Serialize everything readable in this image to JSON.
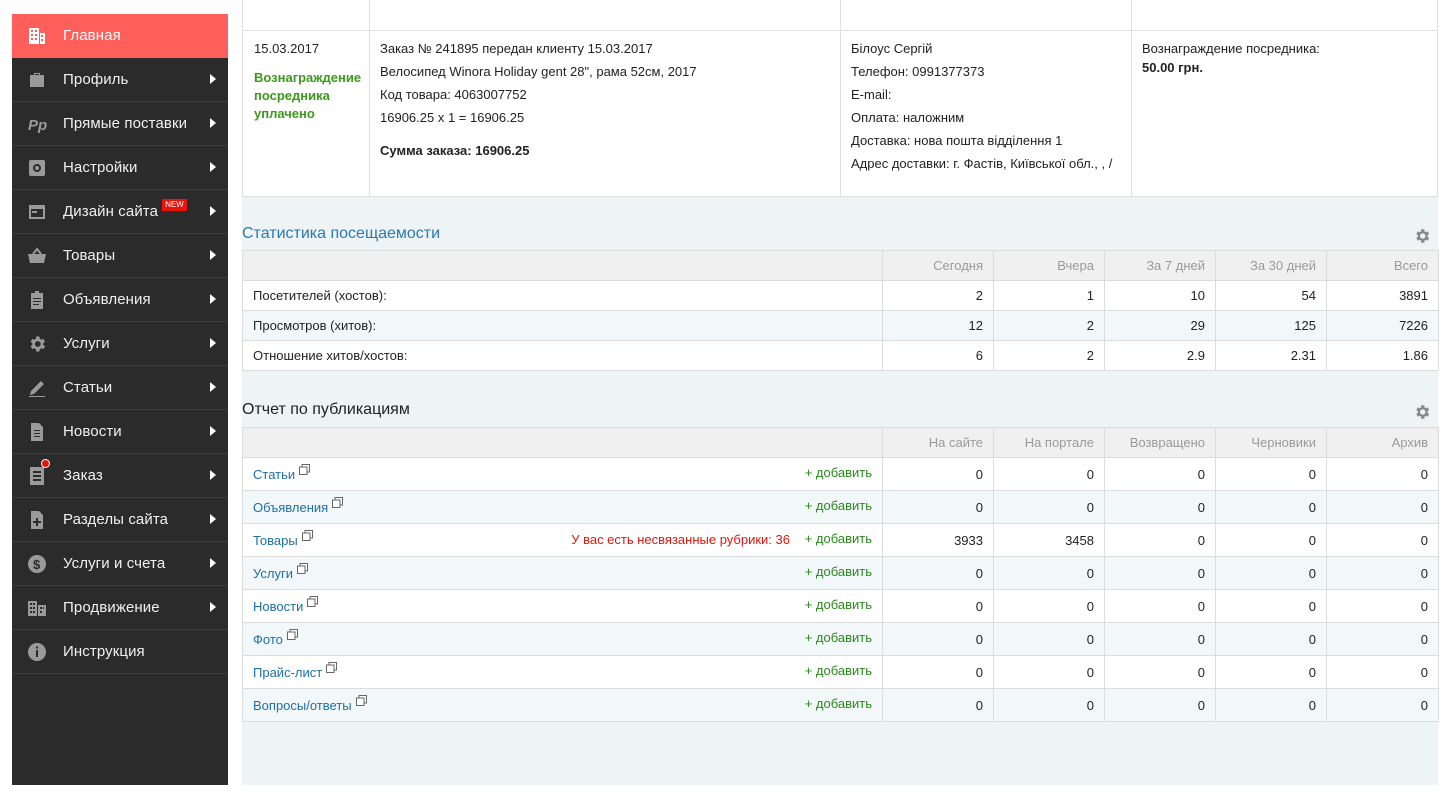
{
  "sidebar": {
    "items": [
      {
        "label": "Главная",
        "icon": "building-icon",
        "active": true,
        "arrow": false
      },
      {
        "label": "Профиль",
        "icon": "briefcase-icon",
        "arrow": true
      },
      {
        "label": "Прямые поставки",
        "icon": "pp-logo-icon",
        "arrow": true
      },
      {
        "label": "Настройки",
        "icon": "settings-box-icon",
        "arrow": true
      },
      {
        "label": "Дизайн сайта",
        "icon": "window-icon",
        "arrow": true,
        "badge": "NEW"
      },
      {
        "label": "Товары",
        "icon": "basket-icon",
        "arrow": true
      },
      {
        "label": "Объявления",
        "icon": "clipboard-icon",
        "arrow": true
      },
      {
        "label": "Услуги",
        "icon": "gear-icon",
        "arrow": true
      },
      {
        "label": "Статьи",
        "icon": "pencil-icon",
        "arrow": true
      },
      {
        "label": "Новости",
        "icon": "document-icon",
        "arrow": true
      },
      {
        "label": "Заказ",
        "icon": "list-icon",
        "arrow": true,
        "notification_dot": true
      },
      {
        "label": "Разделы сайта",
        "icon": "file-plus-icon",
        "arrow": true
      },
      {
        "label": "Услуги и счета",
        "icon": "dollar-icon",
        "arrow": true
      },
      {
        "label": "Продвижение",
        "icon": "buildings-icon",
        "arrow": true
      },
      {
        "label": "Инструкция",
        "icon": "info-icon",
        "arrow": false
      }
    ]
  },
  "order": {
    "date": "15.03.2017",
    "status": "Вознаграждение посредника уплачено",
    "lines": [
      "Заказ № 241895 передан клиенту 15.03.2017",
      "Велосипед Winora Holiday gent 28\", рама 52см, 2017",
      "Код товара: 4063007752",
      "16906.25 x 1 = 16906.25"
    ],
    "total": "Сумма заказа: 16906.25",
    "customer": [
      "Білоус Сергій",
      "Телефон: 0991377373",
      "E-mail:",
      "Оплата: наложним",
      "Доставка: нова пошта відділення 1",
      "Адрес доставки: г. Фастів, Київської обл., , /"
    ],
    "reward_label": "Вознаграждение посредника:",
    "reward_value": "50.00 грн."
  },
  "stats": {
    "title": "Статистика посещаемости",
    "columns": [
      "Сегодня",
      "Вчера",
      "За 7 дней",
      "За 30 дней",
      "Всего"
    ],
    "rows": [
      {
        "label": "Посетителей (хостов):",
        "values": [
          "2",
          "1",
          "10",
          "54",
          "3891"
        ]
      },
      {
        "label": "Просмотров (хитов):",
        "values": [
          "12",
          "2",
          "29",
          "125",
          "7226"
        ]
      },
      {
        "label": "Отношение хитов/хостов:",
        "values": [
          "6",
          "2",
          "2.9",
          "2.31",
          "1.86"
        ]
      }
    ]
  },
  "publications": {
    "title": "Отчет по публикациям",
    "columns": [
      "На сайте",
      "На портале",
      "Возвращено",
      "Черновики",
      "Архив"
    ],
    "add_label": "+ добавить",
    "rows": [
      {
        "name": "Статьи",
        "values": [
          "0",
          "0",
          "0",
          "0",
          "0"
        ]
      },
      {
        "name": "Объявления",
        "values": [
          "0",
          "0",
          "0",
          "0",
          "0"
        ]
      },
      {
        "name": "Товары",
        "warning": "У вас есть несвязанные рубрики: 36",
        "values": [
          "3933",
          "3458",
          "0",
          "0",
          "0"
        ]
      },
      {
        "name": "Услуги",
        "values": [
          "0",
          "0",
          "0",
          "0",
          "0"
        ]
      },
      {
        "name": "Новости",
        "values": [
          "0",
          "0",
          "0",
          "0",
          "0"
        ]
      },
      {
        "name": "Фото",
        "values": [
          "0",
          "0",
          "0",
          "0",
          "0"
        ]
      },
      {
        "name": "Прайс-лист",
        "values": [
          "0",
          "0",
          "0",
          "0",
          "0"
        ]
      },
      {
        "name": "Вопросы/ответы",
        "values": [
          "0",
          "0",
          "0",
          "0",
          "0"
        ]
      }
    ]
  },
  "colors": {
    "sidebar_bg": "#2b2b2b",
    "active_item": "#ff5f5a",
    "link_blue": "#1e6ea8",
    "add_green": "#2a8a1a",
    "warning_red": "#e0140c"
  }
}
